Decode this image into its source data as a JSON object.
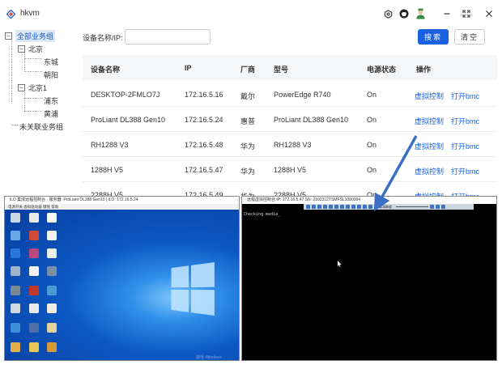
{
  "app": {
    "title": "hkvm"
  },
  "titlebar": {
    "icons": [
      "settings-icon",
      "github-icon",
      "user-avatar-icon",
      "minimize-icon",
      "maximize-icon",
      "close-icon"
    ]
  },
  "tree": {
    "root": "全部业务组",
    "groups": [
      {
        "label": "北京",
        "children": [
          "东城",
          "朝阳"
        ]
      },
      {
        "label": "北京1",
        "children": [
          "浦东",
          "黄浦"
        ]
      }
    ],
    "ungrouped": "未关联业务组"
  },
  "search": {
    "label": "设备名称/IP:",
    "value": "",
    "placeholder": "",
    "search_button": "搜索",
    "clear_button": "清空"
  },
  "table": {
    "headers": [
      "设备名称",
      "IP",
      "厂商",
      "型号",
      "电源状态",
      "操作"
    ],
    "rows": [
      {
        "name": "DESKTOP-2FMLO7J",
        "ip": "172.16.5.16",
        "vendor": "戴尔",
        "model": "PowerEdge R740",
        "power": "On",
        "action1": "虚拟控制",
        "action2": "打开bmc"
      },
      {
        "name": "ProLiant DL388 Gen10",
        "ip": "172.16.5.24",
        "vendor": "惠普",
        "model": "ProLiant DL388 Gen10",
        "power": "On",
        "action1": "虚拟控制",
        "action2": "打开bmc"
      },
      {
        "name": "RH1288 V3",
        "ip": "172.16.5.48",
        "vendor": "华为",
        "model": "RH1288 V3",
        "power": "On",
        "action1": "虚拟控制",
        "action2": "打开bmc"
      },
      {
        "name": "1288H V5",
        "ip": "172.16.5.47",
        "vendor": "华为",
        "model": "1288H V5",
        "power": "On",
        "action1": "虚拟控制",
        "action2": "打开bmc"
      },
      {
        "name": "2288H V5",
        "ip": "172.16.5.49",
        "vendor": "华为",
        "model": "2288H V5",
        "power": "On",
        "action1": "虚拟控制",
        "action2": "打开bmc"
      }
    ]
  },
  "remote_left": {
    "title": "iLO 集成远程控制台 - 服务器: ProLiant DL388 Gen10 | iLO: 172.16.5.24",
    "menu": "电源开关 虚拟驱动器 键盘 帮助",
    "watermark": "激活 Windows"
  },
  "remote_right": {
    "title": "远程虚拟控制台 IP: 172.16.5.47 SN: 2102312TSMFSL1000004",
    "console_text": "Checking media_",
    "toolbar_label": "图像清晰度"
  },
  "colors": {
    "accent": "#1a61df",
    "arrow": "#3a6fc6"
  }
}
